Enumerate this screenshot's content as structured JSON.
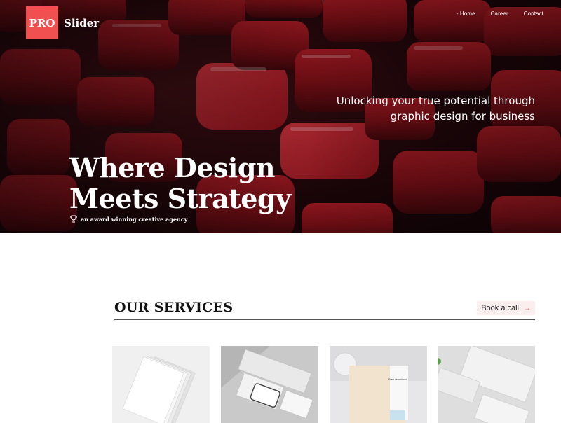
{
  "logo": {
    "badge": "PRO",
    "name": "Slider"
  },
  "nav": {
    "items": [
      "Home",
      "Career",
      "Contact"
    ],
    "active": "Home"
  },
  "hero": {
    "tagline_line1": "Unlocking your true potential through",
    "tagline_line2": "graphic design for business",
    "headline_line1": "Where Design",
    "headline_line2": "Meets Strategy",
    "award_text": "an award winning creative agency",
    "award_icon": "trophy-icon"
  },
  "services": {
    "title": "OUR SERVICES",
    "button_label": "Book a call",
    "button_icon": "arrow-right-icon",
    "cards": [
      {
        "name": "stacked-papers"
      },
      {
        "name": "stationery-mockup"
      },
      {
        "name": "document-mockup",
        "doc_text": "Free download"
      },
      {
        "name": "business-cards"
      }
    ]
  },
  "colors": {
    "brand_red": "#f0504f",
    "hero_dark": "#1a0508",
    "button_bg": "#fbeeee"
  }
}
